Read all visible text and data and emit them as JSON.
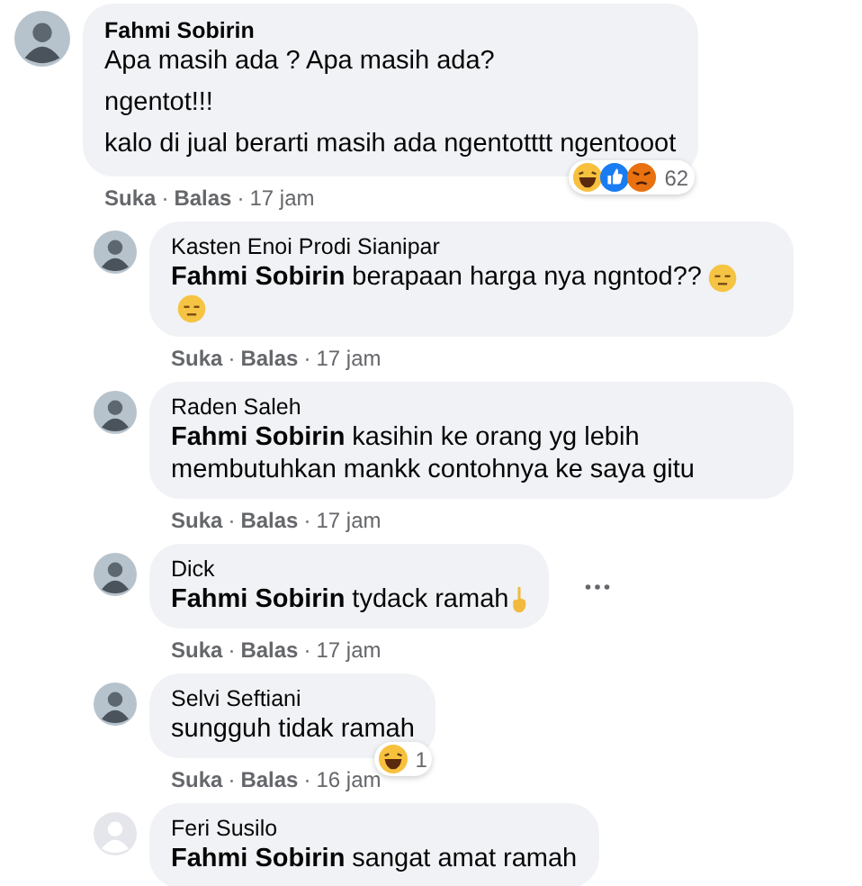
{
  "comments": [
    {
      "kind": "top",
      "author": "Fahmi Sobirin",
      "avatar": {
        "kind": "photo"
      },
      "paragraphs": [
        {
          "text": "Apa masih ada ? Apa masih ada?"
        },
        {
          "text": "ngentot!!!"
        },
        {
          "text": "kalo di jual berarti masih ada ngentotttt ngentooot"
        }
      ],
      "reactions": {
        "icons": [
          {
            "kind": "haha"
          },
          {
            "kind": "like"
          },
          {
            "kind": "angry"
          }
        ],
        "count": "62"
      },
      "actions": [
        {
          "kind": "link",
          "text": "Suka"
        },
        {
          "kind": "sep",
          "text": "·"
        },
        {
          "kind": "link",
          "text": "Balas"
        },
        {
          "kind": "sep",
          "text": "·"
        },
        {
          "kind": "time",
          "text": "17 jam"
        }
      ],
      "more_menu": false
    },
    {
      "kind": "reply",
      "author": "Kasten Enoi Prodi Sianipar",
      "avatar": {
        "kind": "photo"
      },
      "paragraphs": [
        {
          "mention": "Fahmi Sobirin",
          "text": "berapaan harga nya ngntod??",
          "icons": [
            {
              "kind": "expressionless"
            },
            {
              "kind": "expressionless"
            }
          ]
        }
      ],
      "actions": [
        {
          "kind": "link",
          "text": "Suka"
        },
        {
          "kind": "sep",
          "text": "·"
        },
        {
          "kind": "link",
          "text": "Balas"
        },
        {
          "kind": "sep",
          "text": "·"
        },
        {
          "kind": "time",
          "text": "17 jam"
        }
      ],
      "more_menu": false
    },
    {
      "kind": "reply",
      "author": "Raden Saleh",
      "avatar": {
        "kind": "photo"
      },
      "paragraphs": [
        {
          "mention": "Fahmi Sobirin",
          "text": "kasihin ke orang yg lebih membutuhkan mankk contohnya ke saya gitu"
        }
      ],
      "actions": [
        {
          "kind": "link",
          "text": "Suka"
        },
        {
          "kind": "sep",
          "text": "·"
        },
        {
          "kind": "link",
          "text": "Balas"
        },
        {
          "kind": "sep",
          "text": "·"
        },
        {
          "kind": "time",
          "text": "17 jam"
        }
      ],
      "more_menu": false
    },
    {
      "kind": "reply",
      "author": "Dick",
      "avatar": {
        "kind": "photo"
      },
      "paragraphs": [
        {
          "mention": "Fahmi Sobirin",
          "text": "tydack ramah",
          "icons": [
            {
              "kind": "hand"
            }
          ]
        }
      ],
      "actions": [
        {
          "kind": "link",
          "text": "Suka"
        },
        {
          "kind": "sep",
          "text": "·"
        },
        {
          "kind": "link",
          "text": "Balas"
        },
        {
          "kind": "sep",
          "text": "·"
        },
        {
          "kind": "time",
          "text": "17 jam"
        }
      ],
      "more_menu": true
    },
    {
      "kind": "reply",
      "author": "Selvi Seftiani",
      "avatar": {
        "kind": "photo"
      },
      "paragraphs": [
        {
          "text": "sungguh tidak ramah"
        }
      ],
      "reactions": {
        "icons": [
          {
            "kind": "haha"
          }
        ],
        "count": "1"
      },
      "actions": [
        {
          "kind": "link",
          "text": "Suka"
        },
        {
          "kind": "sep",
          "text": "·"
        },
        {
          "kind": "link",
          "text": "Balas"
        },
        {
          "kind": "sep",
          "text": "·"
        },
        {
          "kind": "time",
          "text": "16 jam"
        }
      ],
      "more_menu": false
    },
    {
      "kind": "reply",
      "author": "Feri Susilo",
      "avatar": {
        "kind": "default"
      },
      "paragraphs": [
        {
          "mention": "Fahmi Sobirin",
          "text": "sangat amat ramah"
        }
      ],
      "more_menu": false
    }
  ]
}
